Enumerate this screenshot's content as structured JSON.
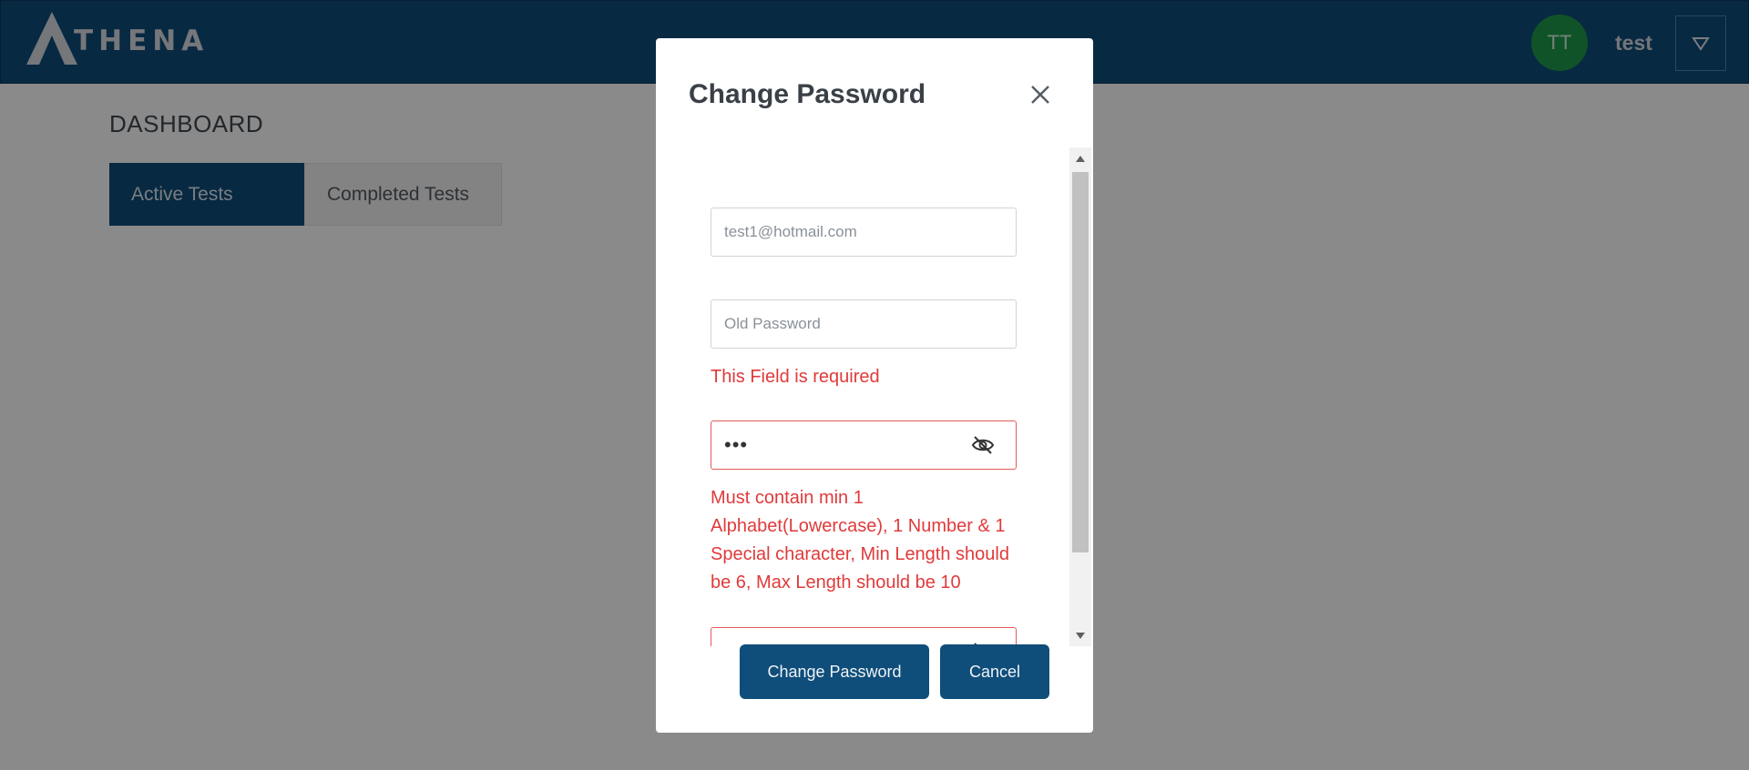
{
  "header": {
    "logo_text": "THENA",
    "avatar_initials": "TT",
    "username": "test"
  },
  "page": {
    "title": "DASHBOARD",
    "tabs": [
      {
        "label": "Active Tests",
        "active": true
      },
      {
        "label": "Completed Tests",
        "active": false
      }
    ]
  },
  "modal": {
    "title": "Change Password",
    "email_placeholder": "test1@hotmail.com",
    "old_password_placeholder": "Old Password",
    "old_password_error": "This Field is required",
    "new_password_value": "•••",
    "new_password_error": "Must contain min 1 Alphabet(Lowercase), 1 Number & 1 Special character, Min Length should be 6, Max Length should be 10",
    "confirm_password_value": "•",
    "submit_label": "Change Password",
    "cancel_label": "Cancel"
  },
  "colors": {
    "brand": "#0f4d7a",
    "avatar": "#1f9a4a",
    "error": "#e03a3a"
  },
  "icons": {
    "close": "close-icon",
    "eye_off": "eye-off-icon",
    "dropdown": "triangle-down-icon"
  }
}
